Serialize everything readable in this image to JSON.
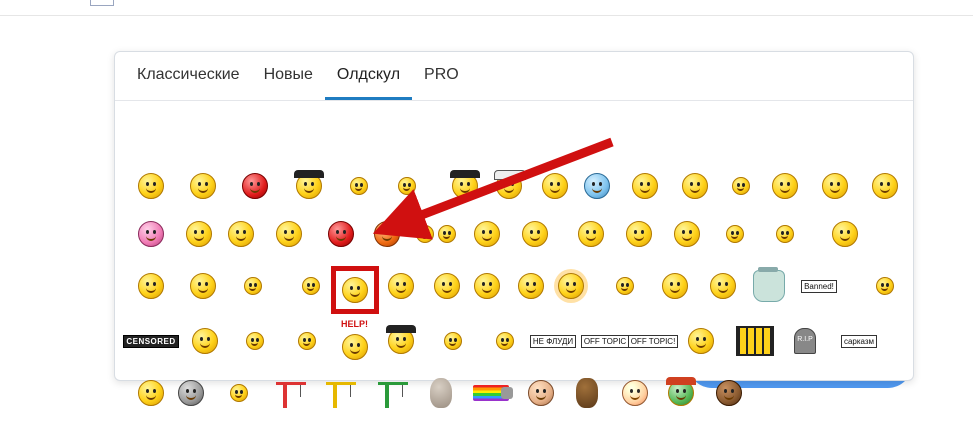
{
  "tabs": [
    {
      "label": "Классические",
      "active": false
    },
    {
      "label": "Новые",
      "active": false
    },
    {
      "label": "Олдскул",
      "active": true
    },
    {
      "label": "PRO",
      "active": false
    }
  ],
  "colors": {
    "accent": "#1f7cc1",
    "highlight": "#d01010",
    "button": "#3d8ef0"
  },
  "emoji_labels": {
    "censored": "CENSORED",
    "help": "HELP!",
    "ne_fluday": "НЕ ФЛУДИ",
    "off_topic_1": "OFF TOPIC",
    "off_topic_2": "OFF TOPIC!",
    "banned": "Banned!",
    "rip": "R.I.P",
    "sarcasm": "сарказм"
  },
  "annotation": {
    "target": "highlighted smiley in row 3, column 6",
    "arrow_color": "#d01010"
  }
}
